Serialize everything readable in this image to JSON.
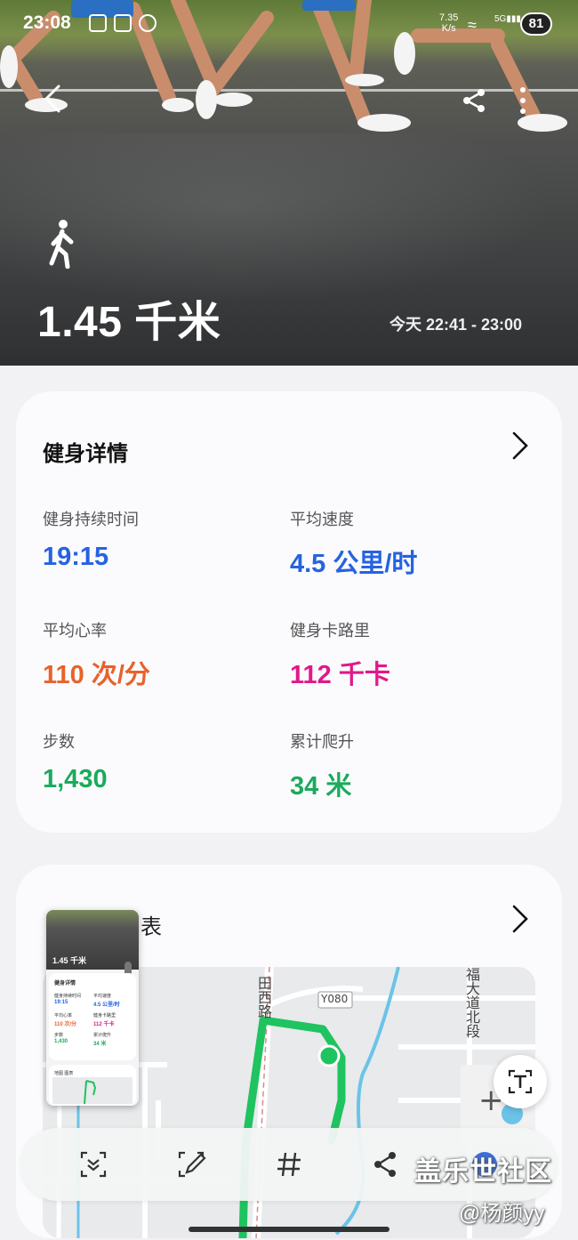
{
  "status_bar": {
    "time": "23:08",
    "net_speed": "7.35\nK/s",
    "battery": "81"
  },
  "hero": {
    "distance": "1.45 千米",
    "time_range": "今天 22:41 - 23:00"
  },
  "details": {
    "title": "健身详情",
    "stats": [
      {
        "label": "健身持续时间",
        "value": "19:15",
        "color": "blue"
      },
      {
        "label": "平均速度",
        "value": "4.5 公里/时",
        "color": "blue"
      },
      {
        "label": "平均心率",
        "value": "110 次/分",
        "color": "orange"
      },
      {
        "label": "健身卡路里",
        "value": "112 千卡",
        "color": "magenta"
      },
      {
        "label": "步数",
        "value": "1,430",
        "color": "green"
      },
      {
        "label": "累计爬升",
        "value": "34 米",
        "color": "green"
      }
    ]
  },
  "map_card": {
    "title_fragment": "表",
    "road_label_1": "田西路",
    "road_code": "Y080",
    "road_label_2": "福大道北段"
  },
  "thumbnail": {
    "distance": "1.45 千米",
    "title": "健身详情",
    "rows": [
      {
        "l": "健身持续时间",
        "v": "19:15"
      },
      {
        "l": "平均速度",
        "v": "4.5 公里/时"
      },
      {
        "l": "平均心率",
        "v": "110 次/分"
      },
      {
        "l": "健身卡路里",
        "v": "112 千卡"
      },
      {
        "l": "步数",
        "v": "1,430"
      },
      {
        "l": "累计爬升",
        "v": "34 米"
      }
    ],
    "map_title": "地图 图表"
  },
  "toolbar": {
    "items": [
      "scroll-capture-icon",
      "edit-icon",
      "hashtag-icon",
      "share-icon",
      "more-icon"
    ]
  },
  "watermark": {
    "line1": "盖乐世社区",
    "line2": "@杨颜yy"
  },
  "colors": {
    "blue": "#2563e0",
    "orange": "#e8622a",
    "magenta": "#e0198a",
    "green": "#1aab5b",
    "route": "#1fc35f"
  }
}
